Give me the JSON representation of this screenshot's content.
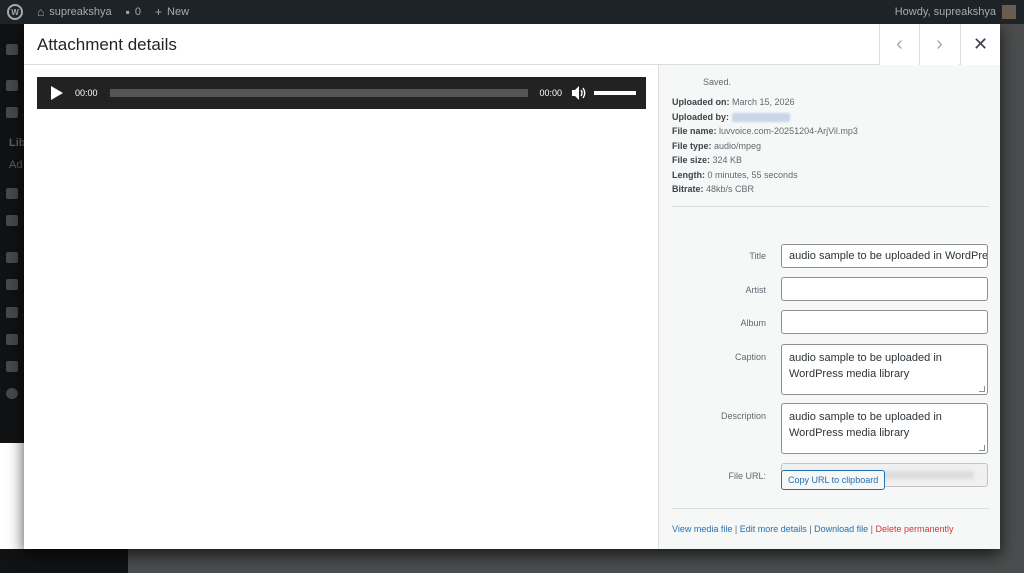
{
  "adminbar": {
    "site_name": "supreakshya",
    "comments_count": "0",
    "new_label": "New",
    "howdy": "Howdy, supreakshya"
  },
  "sidemenu": {
    "text_1": "Lib",
    "text_2": "Ad"
  },
  "modal": {
    "title": "Attachment details",
    "prev_glyph": "‹",
    "next_glyph": "›",
    "close_glyph": "✕"
  },
  "player": {
    "current_time": "00:00",
    "duration": "00:00",
    "progress": 0,
    "volume": 1.0
  },
  "details": {
    "saved": "Saved.",
    "uploaded_on_label": "Uploaded on:",
    "uploaded_on": "March 15, 2026",
    "uploaded_by_label": "Uploaded by:",
    "file_name_label": "File name:",
    "file_name": "luvvoice.com-20251204-ArjVil.mp3",
    "file_type_label": "File type:",
    "file_type": "audio/mpeg",
    "file_size_label": "File size:",
    "file_size": "324 KB",
    "length_label": "Length:",
    "length": "0 minutes, 55 seconds",
    "bitrate_label": "Bitrate:",
    "bitrate": "48kb/s CBR"
  },
  "form": {
    "title_label": "Title",
    "title_value": "audio sample to be uploaded in WordPress media library",
    "artist_label": "Artist",
    "artist_value": "",
    "album_label": "Album",
    "album_value": "",
    "caption_label": "Caption",
    "caption_value": "audio sample to be uploaded in WordPress media library",
    "description_label": "Description",
    "description_value": "audio sample to be uploaded in WordPress media library",
    "file_url_label": "File URL:",
    "copy_button": "Copy URL to clipboard"
  },
  "actions": {
    "view": "View media file",
    "edit": "Edit more details",
    "download": "Download file",
    "delete": "Delete permanently",
    "separator": " | "
  },
  "colors": {
    "link": "#2271b1",
    "danger": "#d63638",
    "adminbar": "#1d2327"
  }
}
